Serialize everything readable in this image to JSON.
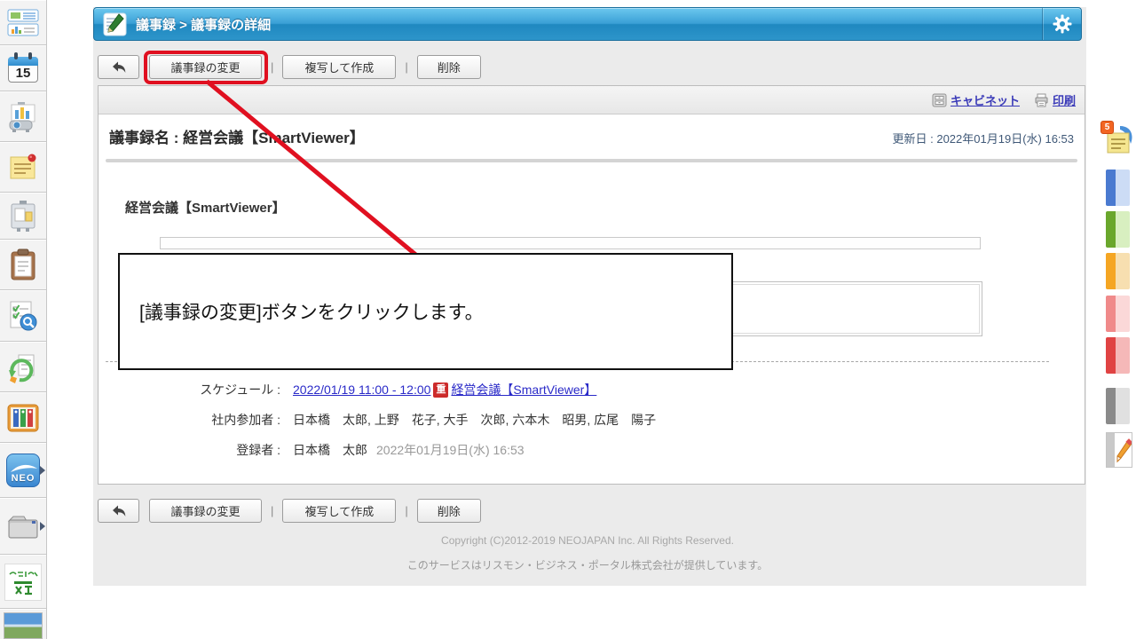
{
  "header": {
    "breadcrumb": "議事録 > 議事録の詳細"
  },
  "toolbar": {
    "change": "議事録の変更",
    "copy": "複写して作成",
    "delete": "削除",
    "separator": "|"
  },
  "panel_links": {
    "cabinet": "キャビネット",
    "print": "印刷"
  },
  "minutes": {
    "title_label": "議事録名 : ",
    "title": "経営会議【SmartViewer】",
    "updated": "更新日 : 2022年01月19日(水) 16:53",
    "subject": "経営会議【SmartViewer】",
    "schedule_label": "スケジュール :",
    "schedule_time": "2022/01/19 11:00 - 12:00",
    "schedule_badge": "重",
    "schedule_title": "経営会議【SmartViewer】",
    "participants_label": "社内参加者 :",
    "participants": "日本橋　太郎, 上野　花子, 大手　次郎, 六本木　昭男, 広尾　陽子",
    "registrant_label": "登録者 :",
    "registrant": "日本橋　太郎",
    "registered_at": "2022年01月19日(水) 16:53"
  },
  "annotation": {
    "text": "[議事録の変更]ボタンをクリックします。"
  },
  "footer": {
    "copyright": "Copyright (C)2012-2019 NEOJAPAN Inc. All Rights Reserved.",
    "provider": "このサービスはリスモン・ビジネス・ポータル株式会社が提供しています。"
  },
  "left_sidebar": {
    "calendar_day": "15",
    "neo_label": "NEO"
  },
  "right_sidebar": {
    "memo_badge_count": "5"
  },
  "icons": {
    "header": [
      "minutes-pad-pencil-icon",
      "gear-icon"
    ],
    "toolbar": [
      "back-arrow-icon"
    ],
    "panel_links": [
      "cabinet-icon",
      "printer-icon"
    ],
    "left_sidebar": [
      "portal-icon",
      "calendar-icon",
      "projector-chart-icon",
      "sticky-note-icon",
      "bulletin-board-icon",
      "clipboard-icon",
      "survey-check-icon",
      "workflow-refresh-icon",
      "binder-shelf-icon",
      "neo-logo-icon",
      "folder-icon",
      "green-text-logo-icon",
      "ad-banner-image"
    ],
    "right_sidebar": [
      "memo-badge-icon",
      "blue-tab-icon",
      "green-tab-icon",
      "orange-tab-icon",
      "pink-tab-icon",
      "red-tab-icon",
      "gray-tab-icon",
      "pencil-icon"
    ]
  },
  "colors": {
    "header_blue": "#2e94c8",
    "annotation_red": "#e01020",
    "link_blue": "#2a2ac8",
    "panel_link_blue": "#3a3ab8",
    "badge_red": "#cc2b2b",
    "content_bg": "#ebebeb"
  }
}
